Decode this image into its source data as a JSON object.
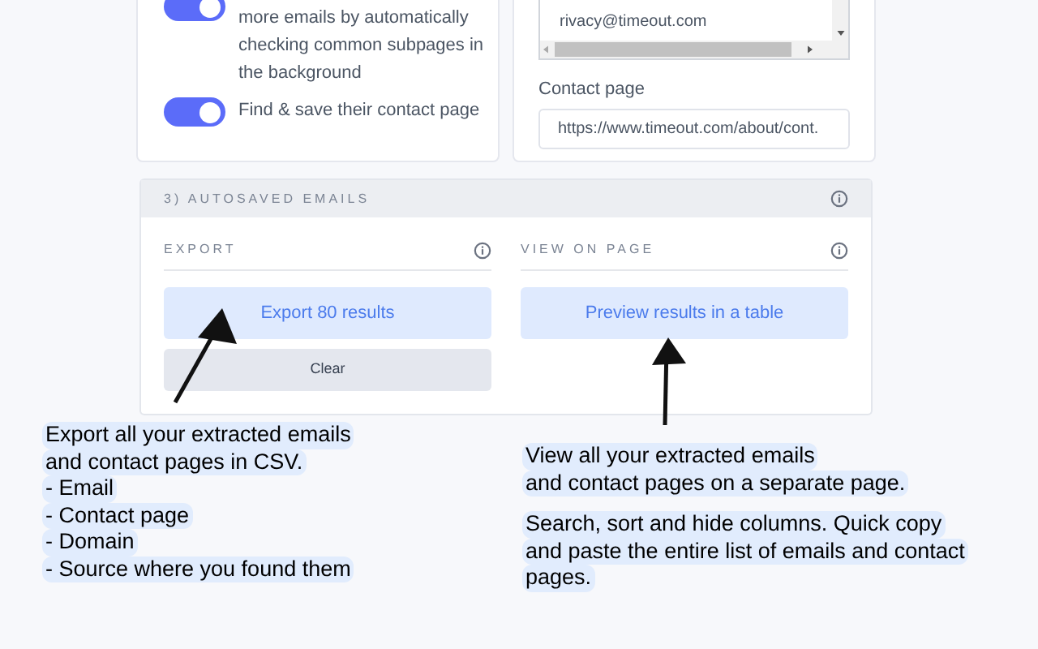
{
  "settings_card": {
    "toggles": [
      {
        "label_lines": [
          "more emails by automatically",
          "checking common subpages in",
          "the background"
        ],
        "on": true
      },
      {
        "label_lines": [
          "Find & save their contact page"
        ],
        "on": true
      }
    ]
  },
  "results_card": {
    "emails": [
      "rivacy@timeout.com"
    ],
    "contact_label": "Contact page",
    "contact_value": "https://www.timeout.com/about/cont."
  },
  "autosaved": {
    "title": "3) AUTOSAVED EMAILS",
    "export": {
      "heading": "EXPORT",
      "primary_button": "Export 80 results",
      "secondary_button": "Clear"
    },
    "view": {
      "heading": "VIEW ON PAGE",
      "primary_button": "Preview results in a table"
    }
  },
  "annotations": [
    {
      "paragraphs": [
        [
          "Export all your extracted emails",
          "and contact pages in CSV.",
          "- Email",
          "- Contact page",
          "- Domain",
          "- Source where you found them"
        ]
      ]
    },
    {
      "paragraphs": [
        [
          "View all your extracted emails",
          "and contact pages on a separate page."
        ],
        [
          "Search, sort and hide columns. Quick copy",
          "and paste the entire list of emails and contact",
          "pages."
        ]
      ]
    }
  ]
}
